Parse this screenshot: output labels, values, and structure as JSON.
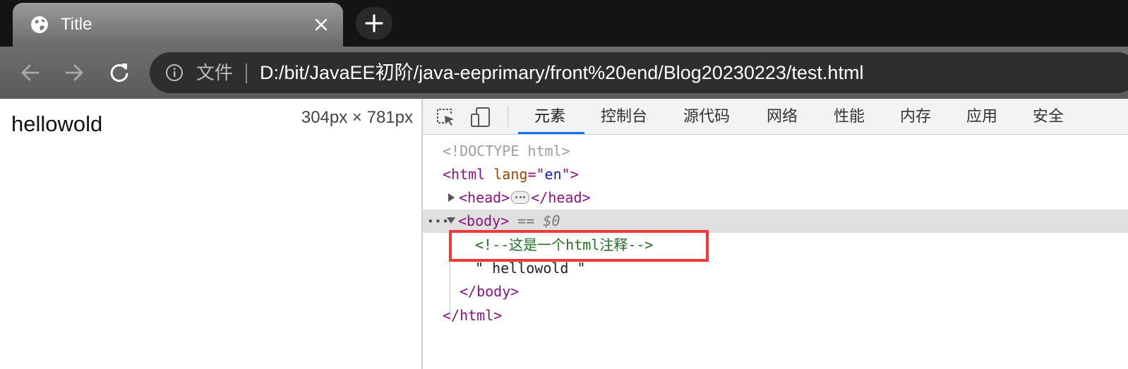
{
  "browser": {
    "tab": {
      "title": "Title",
      "favicon": "globe-icon",
      "close_icon": "close-icon"
    },
    "new_tab_icon": "plus-icon",
    "toolbar": {
      "back_icon": "arrow-left-icon",
      "forward_icon": "arrow-right-icon",
      "reload_icon": "reload-icon",
      "site_info_icon": "info-circle-icon",
      "scheme_label": "文件",
      "url": "D:/bit/JavaEE初阶/java-eeprimary/front%20end/Blog20230223/test.html"
    }
  },
  "page": {
    "body_text": "hellowold",
    "viewport_size": "304px × 781px"
  },
  "devtools": {
    "toolbar_icons": [
      "inspect-element-icon",
      "device-toggle-icon"
    ],
    "tabs": [
      {
        "label": "元素",
        "active": true
      },
      {
        "label": "控制台",
        "active": false
      },
      {
        "label": "源代码",
        "active": false
      },
      {
        "label": "网络",
        "active": false
      },
      {
        "label": "性能",
        "active": false
      },
      {
        "label": "内存",
        "active": false
      },
      {
        "label": "应用",
        "active": false
      },
      {
        "label": "安全",
        "active": false
      }
    ],
    "elements": {
      "doctype": "<!DOCTYPE html>",
      "html_open": "<html",
      "html_attr_name": "lang",
      "html_attr_eq": "=\"",
      "html_attr_value": "en",
      "html_attr_close": "\">",
      "head_open": "<head>",
      "head_close": "</head>",
      "body_open": "<body>",
      "selected_marker": "== $0",
      "comment": "<!--这是一个html注释-->",
      "text_node": "\" hellowold \"",
      "body_close": "</body>",
      "html_close": "</html>"
    },
    "highlight_color": "#f0383b",
    "accent_color": "#1a73e8"
  }
}
